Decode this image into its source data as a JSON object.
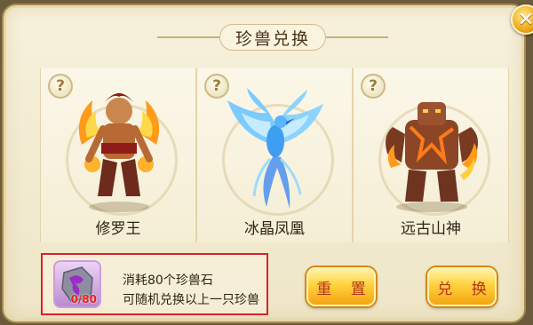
{
  "dialog": {
    "title": "珍兽兑换",
    "close_label": "✕"
  },
  "beasts": [
    {
      "name": "修罗王",
      "help": "?"
    },
    {
      "name": "冰晶凤凰",
      "help": "?"
    },
    {
      "name": "远古山神",
      "help": "?"
    }
  ],
  "cost": {
    "stone_count": "0/80",
    "line1": "消耗80个珍兽石",
    "line2": "可随机兑换以上一只珍兽"
  },
  "buttons": {
    "reset_label": "重 置",
    "exchange_label": "兑 换"
  }
}
